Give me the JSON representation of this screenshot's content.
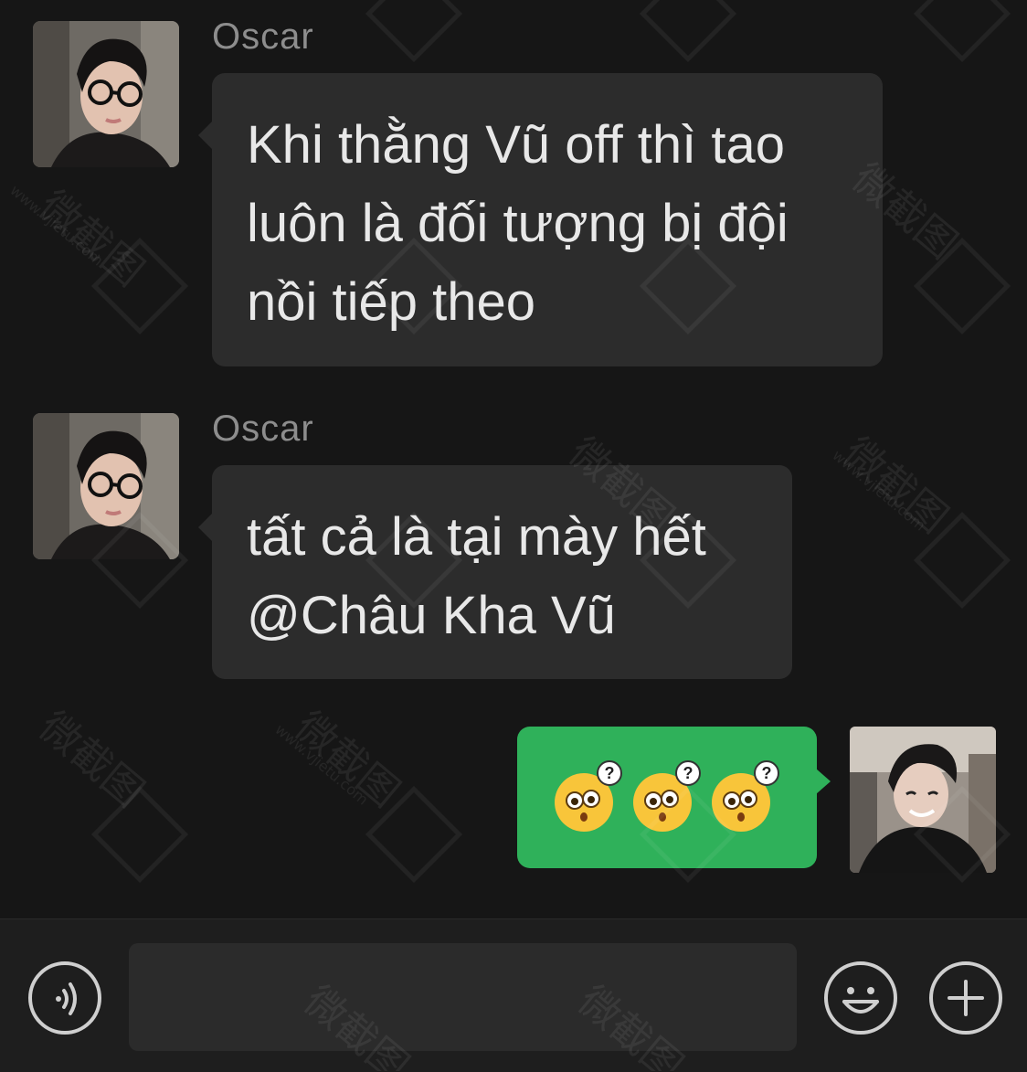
{
  "messages": [
    {
      "sender": "Oscar",
      "direction": "incoming",
      "lines": [
        "Khi thằng Vũ off thì tao",
        "luôn là đối tượng bị đội",
        "nồi tiếp theo"
      ]
    },
    {
      "sender": "Oscar",
      "direction": "incoming",
      "lines": [
        "tất cả là tại mày hết",
        "@Châu Kha Vũ"
      ]
    },
    {
      "sender": "",
      "direction": "outgoing",
      "stickers": [
        "confused-emoji",
        "confused-emoji",
        "confused-emoji"
      ]
    }
  ],
  "input_bar": {
    "voice_icon": "voice-icon",
    "input_value": "",
    "emoji_icon": "emoji-icon",
    "plus_icon": "plus-icon"
  },
  "colors": {
    "background": "#161616",
    "incoming_bubble": "#2c2c2c",
    "outgoing_bubble": "#2fb15a",
    "sender_name": "#8d8d8d",
    "message_text": "#e8e8e8"
  },
  "watermark": {
    "text": "微截图",
    "url": "www.vjietu.com"
  }
}
